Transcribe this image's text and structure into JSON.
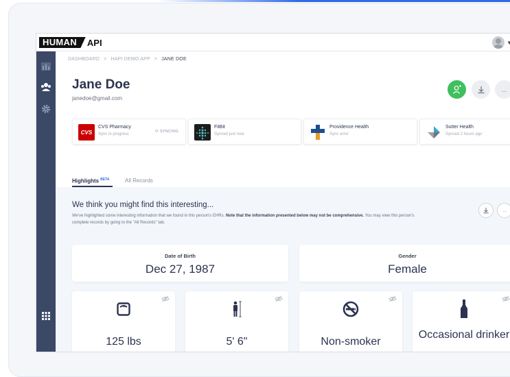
{
  "app": {
    "logo_box": "HUMAN",
    "logo_text": "API"
  },
  "breadcrumb": {
    "items": [
      "DASHBOARD",
      "HAPI DEMO APP",
      "JANE DOE"
    ],
    "separator": ">"
  },
  "profile": {
    "name": "Jane Doe",
    "email": "janedoe@gmail.com"
  },
  "actions": {
    "more_label": "..."
  },
  "sources": [
    {
      "logo_text": "CVS",
      "name": "CVS Pharmacy",
      "status": "Sync in progress",
      "badge": "SYNCING"
    },
    {
      "name": "FitBit",
      "status": "Synced just now"
    },
    {
      "name": "Providence Health",
      "status": "Sync error"
    },
    {
      "name": "Sutter Health",
      "status": "Synced 2 hours ago"
    }
  ],
  "tabs": {
    "highlights_label": "Highlights",
    "highlights_badge": "BETA",
    "all_records_label": "All Records"
  },
  "highlights": {
    "title": "We think you might find this interesting...",
    "desc_plain": "We've highlighted some interesting information that we found in this person's EHRs. ",
    "desc_bold": "Note that the information presented below may not be comprehensive.",
    "desc_tail": " You may view this person's complete records by going to the \"All Records\" tab.",
    "more_label": "..."
  },
  "facts": {
    "dob_label": "Date of Birth",
    "dob_value": "Dec 27, 1987",
    "gender_label": "Gender",
    "gender_value": "Female"
  },
  "stats": [
    {
      "icon": "scale-icon",
      "value": "125 lbs"
    },
    {
      "icon": "height-icon",
      "value": "5' 6\""
    },
    {
      "icon": "no-smoking-icon",
      "value": "Non-smoker"
    },
    {
      "icon": "bottle-icon",
      "value": "Occasional drinker"
    }
  ],
  "colors": {
    "sidebar": "#3b4866",
    "accent_green": "#3fbf5d",
    "accent_blue": "#2f6be8",
    "text_dark": "#2b3350",
    "cvs_red": "#cc0000"
  }
}
